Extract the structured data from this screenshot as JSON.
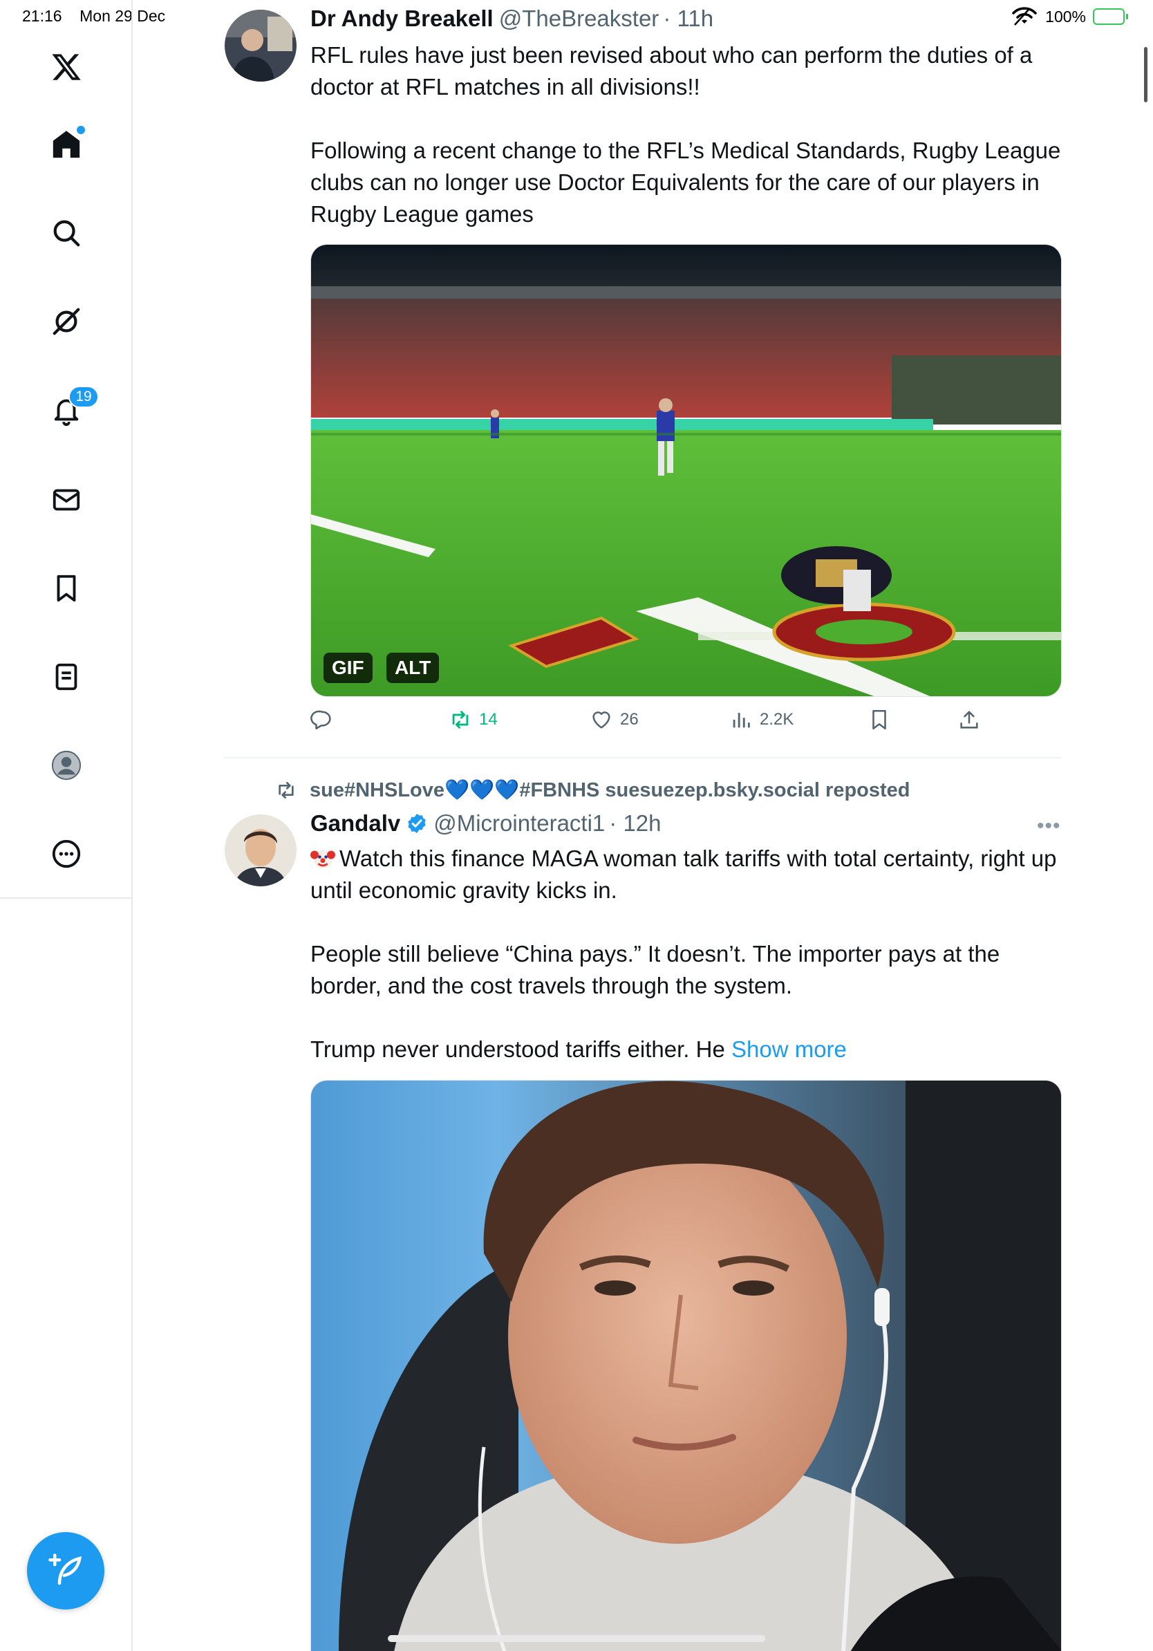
{
  "status_bar": {
    "time": "21:16",
    "date": "Mon 29 Dec",
    "battery": "100%"
  },
  "nav": {
    "notifications_badge": "19"
  },
  "tweets": [
    {
      "name": "Dr Andy Breakell",
      "handle": "@TheBreakster",
      "time": "· 11h",
      "paragraphs": [
        "RFL rules have just been revised about who can perform the duties of a doctor at RFL matches in all divisions!!",
        "Following a recent change to the RFL’s Medical Standards, Rugby League clubs can no longer use Doctor Equivalents for the care of our players in Rugby League games"
      ],
      "media_badges": [
        "GIF",
        "ALT"
      ],
      "stats": {
        "reposts": "14",
        "likes": "26",
        "views": "2.2K"
      }
    },
    {
      "repost_by": "sue#NHSLove💙💙💙#FBNHS suesuezep.bsky.social reposted",
      "name": "Gandalv",
      "handle": "@Microinteracti1",
      "time": "· 12h",
      "more": "•••",
      "paragraphs": [
        "Watch this finance MAGA woman talk tariffs with total certainty, right up until economic gravity kicks in.",
        "People still believe “China pays.” It doesn’t. The importer pays at the border, and the cost travels through the system.",
        "Trump never understood tariffs either. He"
      ],
      "show_more": "Show more"
    }
  ],
  "colors": {
    "accent": "#1d9bf0",
    "repost_green": "#00ba7c",
    "text": "#0f1419",
    "muted": "#536471",
    "divider": "#eff3f4"
  },
  "icons": {
    "rail": [
      "x-logo-icon",
      "home-icon",
      "search-icon",
      "grok-icon",
      "bell-icon",
      "mail-icon",
      "bookmark-icon",
      "lists-icon",
      "profile-icon",
      "more-icon"
    ],
    "actions": [
      "reply-icon",
      "repost-icon",
      "like-icon",
      "views-icon",
      "bookmark-icon",
      "share-icon"
    ]
  }
}
